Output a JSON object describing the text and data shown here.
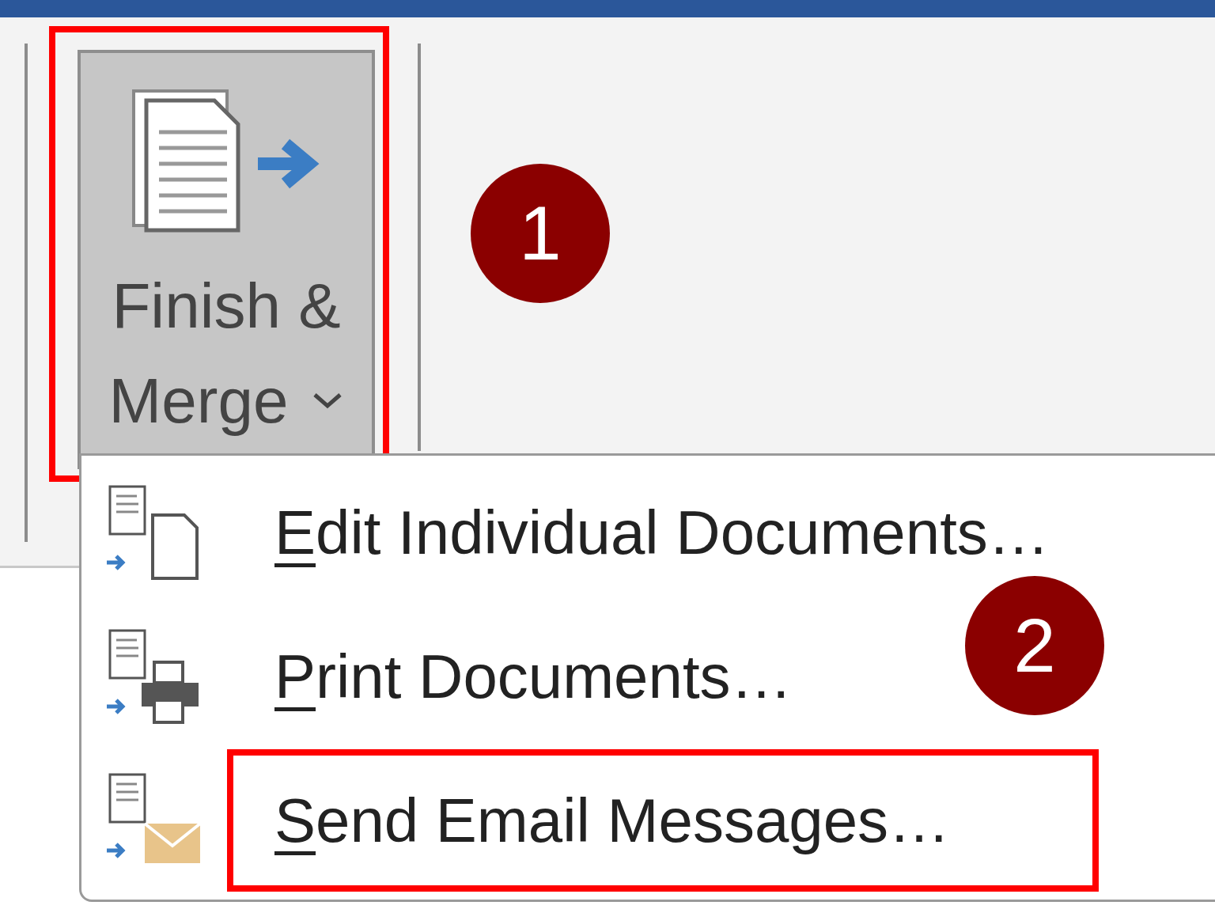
{
  "ribbon": {
    "button": {
      "label_lines": [
        "Finish &",
        "Merge"
      ],
      "pressed": true,
      "highlighted": true
    }
  },
  "menu": {
    "items": [
      {
        "kind": "edit",
        "label": "Edit Individual Documents…",
        "access_key_underlined": true,
        "highlighted": false
      },
      {
        "kind": "print",
        "label": "Print Documents…",
        "access_key_underlined": true,
        "highlighted": false
      },
      {
        "kind": "email",
        "label": "Send Email Messages…",
        "access_key_underlined": true,
        "highlighted": true
      }
    ]
  },
  "annotations": [
    {
      "label": "1"
    },
    {
      "label": "2"
    }
  ]
}
